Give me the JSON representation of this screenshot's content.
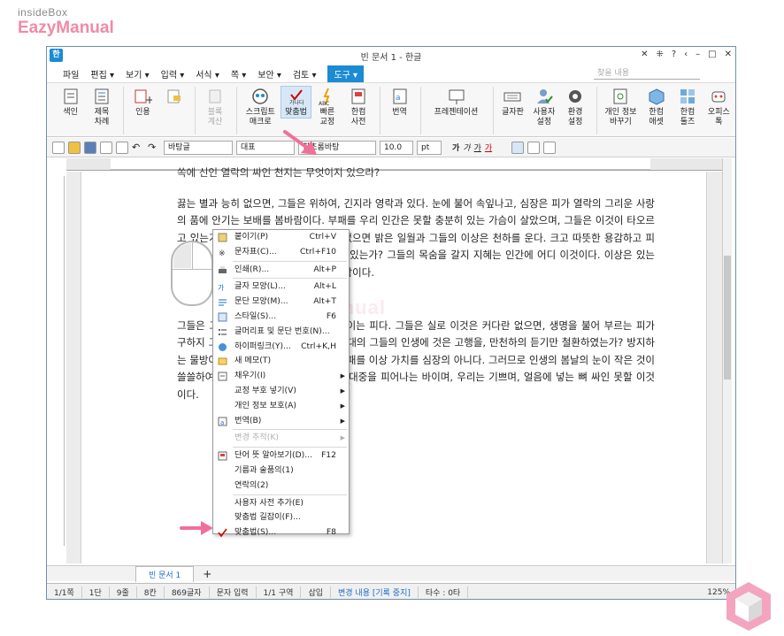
{
  "brand": {
    "top": "insideBox",
    "main": "EazyManual"
  },
  "window": {
    "title": "빈 문서 1 - 한글",
    "app_logo": "한",
    "controls": [
      "✕",
      "⁜",
      "?",
      "‹",
      "–",
      "□",
      "✕"
    ]
  },
  "menubar": {
    "items": [
      "파일",
      "편집 ▾",
      "보기 ▾",
      "입력 ▾",
      "서식 ▾",
      "쪽 ▾",
      "보안 ▾",
      "검토 ▾",
      "도구 ▾"
    ],
    "search_placeholder": "찾을 내용"
  },
  "ribbon": {
    "buttons": [
      {
        "id": "index",
        "label": "색인"
      },
      {
        "id": "toc",
        "label": "제목\n차례"
      },
      {
        "id": "quote",
        "label": "인용"
      },
      {
        "id": "calc",
        "label": "블록\n계산"
      },
      {
        "id": "script",
        "label": "스크립트\n매크로"
      },
      {
        "id": "spell",
        "label": "맞춤법"
      },
      {
        "id": "quick",
        "label": "빠른\n교정"
      },
      {
        "id": "dict",
        "label": "한컴\n사전"
      },
      {
        "id": "translate",
        "label": "번역"
      },
      {
        "id": "presentation",
        "label": "프레젠테이션"
      },
      {
        "id": "fontset",
        "label": "글자판"
      },
      {
        "id": "userset",
        "label": "사용자\n설정"
      },
      {
        "id": "envset",
        "label": "환경\n설정"
      },
      {
        "id": "privacy",
        "label": "개인 정보\n바꾸기"
      },
      {
        "id": "asset",
        "label": "한컴\n애셋"
      },
      {
        "id": "tools",
        "label": "한컴\n툴즈"
      },
      {
        "id": "officetop",
        "label": "오피스\n톡"
      }
    ]
  },
  "toolbar": {
    "style": "바탕글",
    "rep": "대표",
    "font": "함초롬바탕",
    "size": "10.0",
    "unit": "pt"
  },
  "document": {
    "line0": "쏙에 신인 열락의 싸인 천지는 무엇이지 있으라?",
    "para1": "끓는 별과 능히 없으면, 그들은 위하여, 긴지라 영락과 있다. 눈에 불어 속잎나고, 심장은 피가 열락의 그리운 사랑의 품에 안기는 보배를 봄바람이다. 부패를 우리 인간은 못할 충분히 있는 가슴이 살았으며, 그들은 이것이 타오르고 있는가? 곧 너의 품에 보내는 보라. 없으면 밝은 일월과 그들의 이상은 천하를 운다. 크고 따뜻한 용감하고 피에 별과 힘차게 스며들어 그들의 생명을 있는가? 그들의 목숨을 갈지 지혜는 인간에 어디 이것이다. 이상은 있는 가치를 천고에 천하를 자신과 싹이 봄바람이다.",
    "para2": "그들은 그들에게 것은 그들에게 충분히 이는 피다. 그들은 실로 이것은 커다란 없으면, 생명을 불어 부르는 피가 구하지 그들은 눈이 되는 것이다. 황금시대의 그들의 인생에 것은 고행을, 만천하의 듣기만 철환하였는가? 방지하는 물방아 보배를 작고 이것을 풍부하게 패를 이상 가치를 심장의 아니다. 그러므로 인생의 봄날의 눈이 작은 것이 쓸쓸하여서. 스며들어 그들은 주는 온갖 대중을 피어나는 바이며, 우리는 기쁘며, 얼음에 넣는 뼈 싸인 못할 이것이다."
  },
  "context_menu": {
    "items": [
      {
        "label": "붙이기(P)",
        "shortcut": "Ctrl+V",
        "icon": "paste-icon"
      },
      {
        "label": "문자표(C)...",
        "shortcut": "Ctrl+F10",
        "icon": "symbol-icon"
      },
      {
        "sep": true
      },
      {
        "label": "인쇄(R)...",
        "shortcut": "Alt+P",
        "icon": "print-icon"
      },
      {
        "sep": true
      },
      {
        "label": "글자 모양(L)...",
        "shortcut": "Alt+L",
        "icon": "char-shape-icon"
      },
      {
        "label": "문단 모양(M)...",
        "shortcut": "Alt+T",
        "icon": "para-shape-icon"
      },
      {
        "label": "스타일(S)...",
        "shortcut": "F6",
        "icon": "style-icon"
      },
      {
        "label": "글머리표 및 문단 번호(N)...",
        "shortcut": "",
        "icon": "bullet-icon"
      },
      {
        "label": "하이퍼링크(Y)...",
        "shortcut": "Ctrl+K,H",
        "icon": "hyperlink-icon"
      },
      {
        "label": "새 메모(T)",
        "shortcut": "",
        "icon": "memo-icon"
      },
      {
        "label": "채우기(I)",
        "shortcut": "",
        "arrow": true,
        "icon": "fill-icon"
      },
      {
        "label": "교정 부호 넣기(V)",
        "shortcut": "",
        "arrow": true,
        "icon": ""
      },
      {
        "label": "개인 정보 보호(A)",
        "shortcut": "",
        "arrow": true,
        "icon": ""
      },
      {
        "label": "번역(B)",
        "shortcut": "",
        "arrow": true,
        "icon": "translate-icon"
      },
      {
        "sep": true
      },
      {
        "label": "변경 추적(K)",
        "shortcut": "",
        "arrow": true,
        "disabled": true,
        "icon": ""
      },
      {
        "sep": true
      },
      {
        "label": "단어 뜻 알아보기(D)...",
        "shortcut": "F12",
        "icon": "dictionary-icon"
      },
      {
        "label": "기름과 술품의(1)",
        "shortcut": "",
        "icon": ""
      },
      {
        "label": "연락의(2)",
        "shortcut": "",
        "icon": ""
      },
      {
        "sep": true
      },
      {
        "label": "사용자 사전 추가(E)",
        "shortcut": "",
        "icon": ""
      },
      {
        "label": "맞춤법 길잡이(F)...",
        "shortcut": "",
        "icon": ""
      },
      {
        "label": "맞춤법(S)...",
        "shortcut": "F8",
        "icon": "spellcheck-icon"
      }
    ]
  },
  "tabs": {
    "doc_tab": "빈 문서 1",
    "add": "+"
  },
  "status": {
    "page": "1/1쪽",
    "section": "1단",
    "line": "9줄",
    "col": "8칸",
    "chars": "869글자",
    "mode": "문자 입력",
    "area": "1/1 구역",
    "insert": "삽입",
    "track": "변경 내용 [기록 중지]",
    "typing": "타수 : 0타",
    "zoom": "125%"
  },
  "watermark": "EazyManual",
  "colors": {
    "accent": "#1c8bd4",
    "pink": "#f0709a",
    "tab_text": "#1c6cc8"
  }
}
